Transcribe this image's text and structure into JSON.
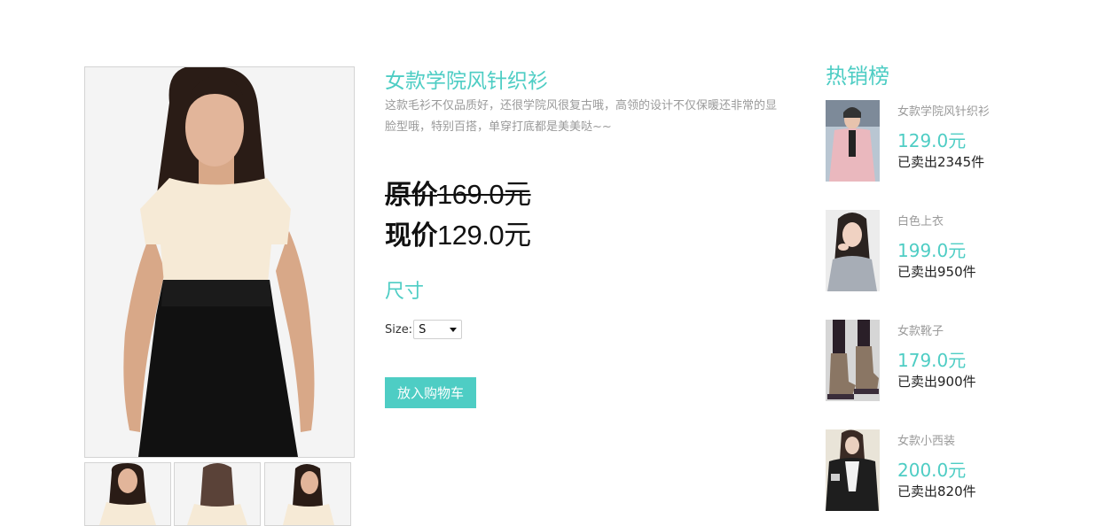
{
  "product": {
    "title": "女款学院风针织衫",
    "description": "这款毛衫不仅品质好，还很学院风很复古哦，高领的设计不仅保暖还非常的显脸型哦，特别百搭，单穿打底都是美美哒~~",
    "original_price_label": "原价",
    "original_price_value": "169.0元",
    "current_price_label": "现价",
    "current_price_value": "129.0元",
    "size_heading": "尺寸",
    "size_label": "Size:",
    "size_selected": "S",
    "add_to_cart_label": "放入购物车"
  },
  "gallery": {
    "thumbnails": [
      "front-view",
      "back-view",
      "side-view"
    ]
  },
  "hot_list": {
    "title": "热销榜",
    "items": [
      {
        "name": "女款学院风针织衫",
        "price": "129.0元",
        "sold": "已卖出2345件"
      },
      {
        "name": "白色上衣",
        "price": "199.0元",
        "sold": "已卖出950件"
      },
      {
        "name": "女款靴子",
        "price": "179.0元",
        "sold": "已卖出900件"
      },
      {
        "name": "女款小西装",
        "price": "200.0元",
        "sold": "已卖出820件"
      }
    ]
  },
  "colors": {
    "accent": "#4ecdc4",
    "muted_text": "#9a9a9a",
    "dark_text": "#111111"
  }
}
